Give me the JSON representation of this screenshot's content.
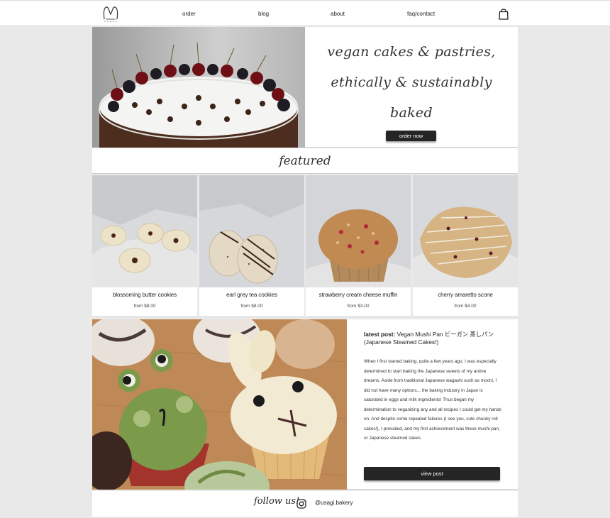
{
  "nav": {
    "links": [
      "order",
      "blog",
      "about",
      "faq/contact"
    ]
  },
  "hero": {
    "tagline_lines": [
      "vegan cakes & pastries,",
      "ethically & sustainably",
      "baked"
    ],
    "button": "order now"
  },
  "featured": {
    "title": "featured",
    "products": [
      {
        "name": "blossoming butter cookies",
        "price": "from $8.00"
      },
      {
        "name": "earl grey tea cookies",
        "price": "from $8.00"
      },
      {
        "name": "strawberry cream cheese muffin",
        "price": "from $3.00"
      },
      {
        "name": "cherry amaretto scone",
        "price": "from $4.00"
      }
    ]
  },
  "blog": {
    "label": "latest post:",
    "title": "Vegan Mushi Pan ビーガン 蒸しパン (Japanese Steamed Cakes!)",
    "body": "When I first started baking, quite a few years ago, I was especially determined to start baking the Japanese sweets of my anime dreams. Aside from traditional Japanese wagashi such as mochi, I did not have many options... the baking industry in Japan is saturated in eggs and milk ingredients! Thus began my determination to veganizing any and all recipes I could get my hands on. And despite some repeated failures (I see you, cute chunky roll cakes!), I prevailed, and my first achievement was these mushi pan, or Japanese steamed cakes.",
    "button": "view post"
  },
  "footer": {
    "follow": "follow us!",
    "handle": "@usagi.bakery"
  },
  "colors": {
    "page_bg": "#e9e9e9",
    "panel_bg": "#ffffff",
    "button_bg": "#252525"
  }
}
